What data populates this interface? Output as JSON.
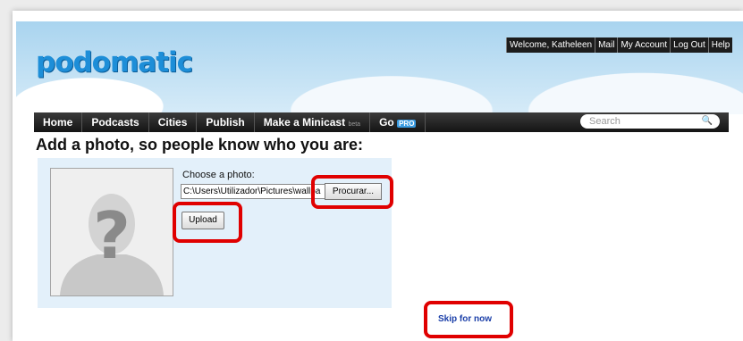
{
  "header": {
    "logo": "podomatic",
    "user_links": [
      "Welcome, Katheleen",
      "Mail",
      "My Account",
      "Log Out",
      "Help"
    ]
  },
  "nav": {
    "home": "Home",
    "podcasts": "Podcasts",
    "cities": "Cities",
    "publish": "Publish",
    "minicast": "Make a Minicast",
    "minicast_badge": "beta",
    "go": "Go",
    "go_badge": "PRO",
    "search_placeholder": "Search"
  },
  "main": {
    "heading": "Add a photo, so people know who you are:",
    "choose_label": "Choose a photo:",
    "file_path": "C:\\Users\\Utilizador\\Pictures\\wallpa",
    "browse_button": "Procurar...",
    "upload_button": "Upload",
    "skip_link": "Skip for now"
  },
  "colors": {
    "highlight": "#e00000",
    "link": "#1a3ea8",
    "panel_bg": "#e3f0fa"
  }
}
